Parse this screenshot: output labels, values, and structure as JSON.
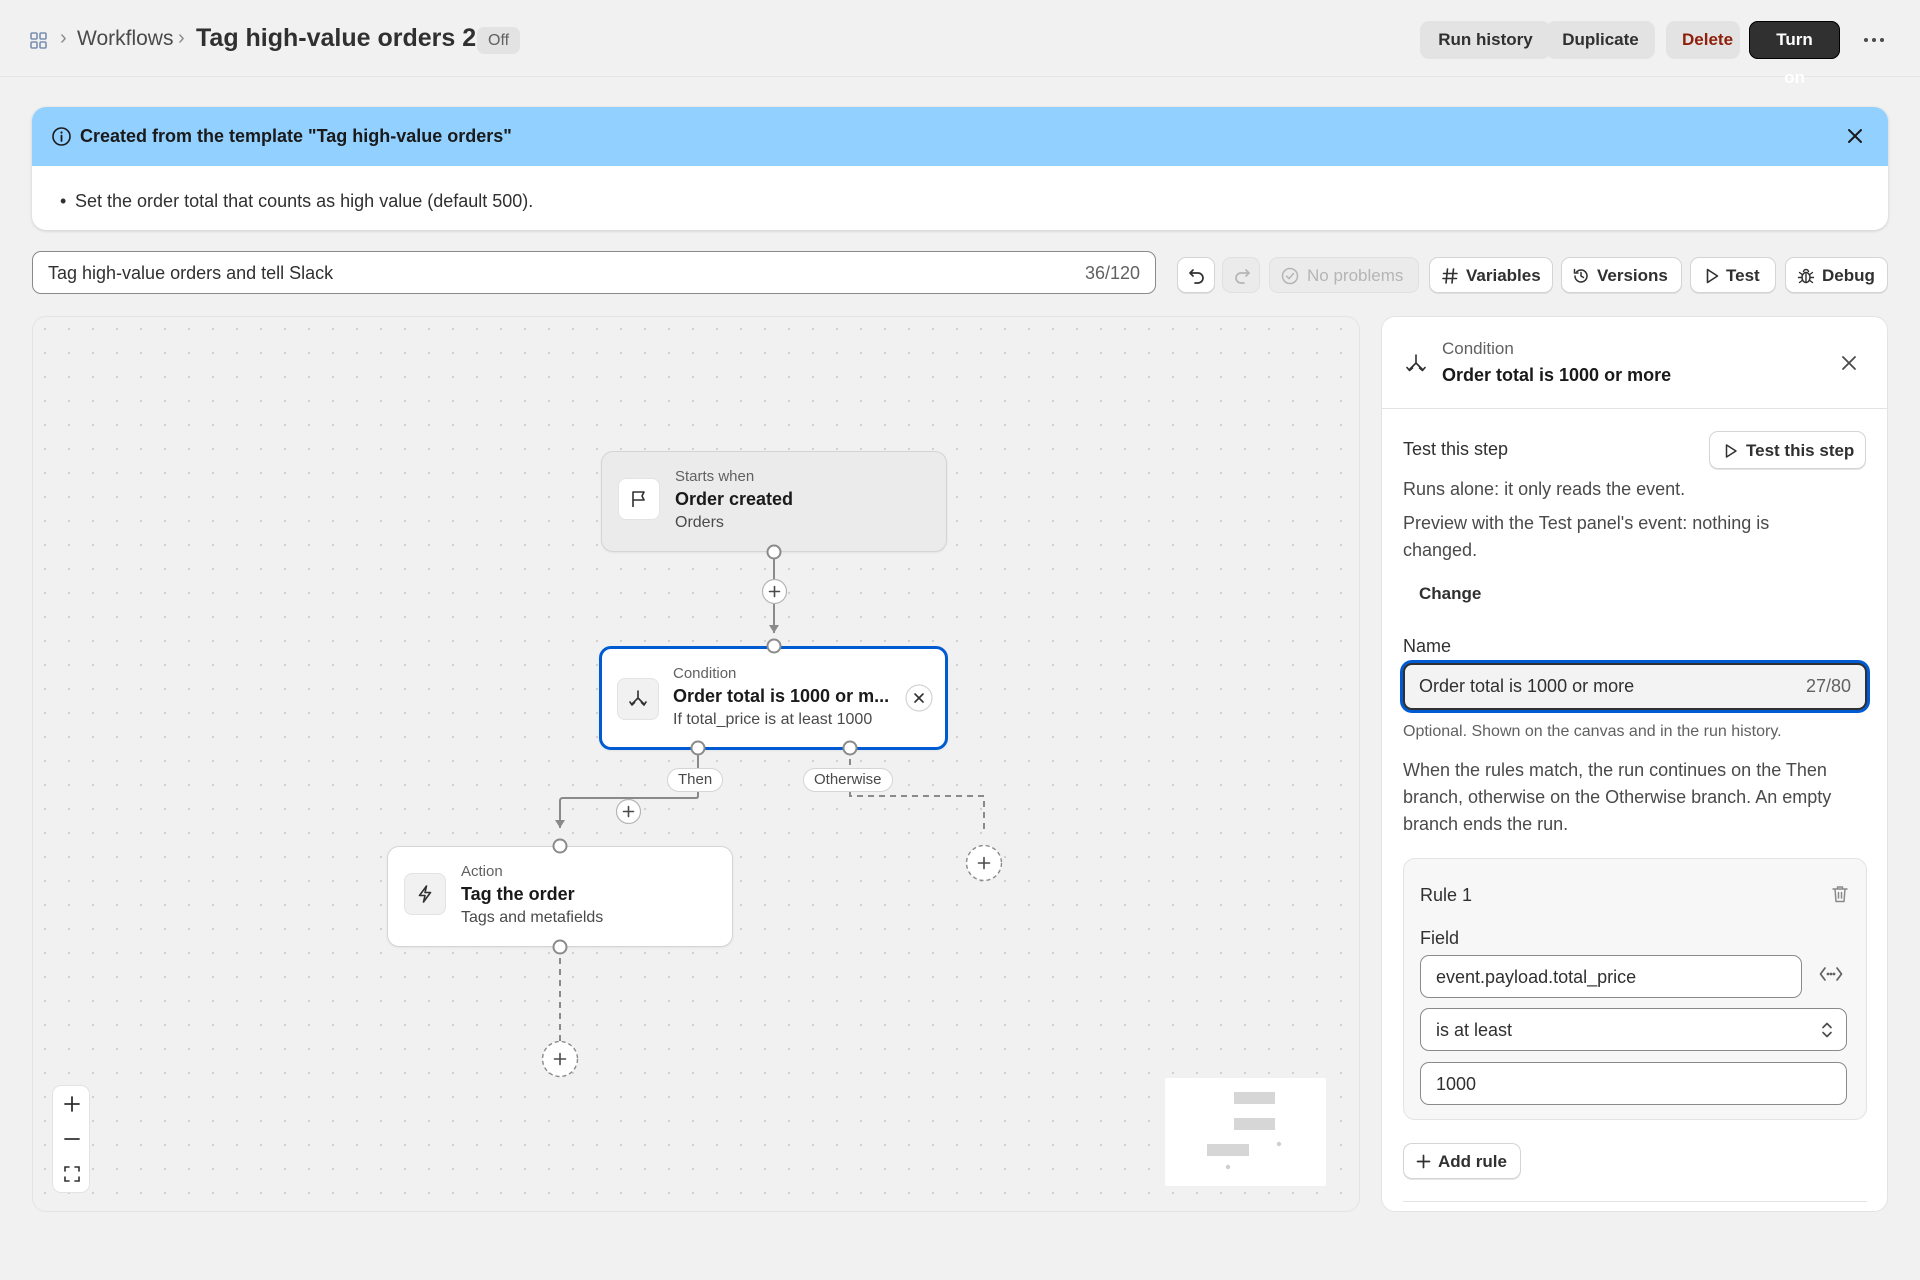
{
  "header": {
    "breadcrumb": "Workflows",
    "title": "Tag high-value orders 2",
    "status": "Off",
    "actions": {
      "run_history": "Run history",
      "duplicate": "Duplicate",
      "delete": "Delete",
      "turn_on": "Turn on"
    }
  },
  "banner": {
    "title": "Created from the template \"Tag high-value orders\"",
    "items": [
      "Set the order total that counts as high value (default 500)."
    ]
  },
  "description": {
    "value": "Tag high-value orders and tell Slack",
    "count": "36/120"
  },
  "toolbar": {
    "status": "No problems",
    "variables": "Variables",
    "versions": "Versions",
    "test": "Test",
    "debug": "Debug"
  },
  "canvas": {
    "trigger": {
      "kicker": "Starts when",
      "title": "Order created",
      "subtitle": "Orders"
    },
    "condition": {
      "kicker": "Condition",
      "title": "Order total is 1000 or m...",
      "subtitle": "If total_price is at least 1000"
    },
    "branches": {
      "then": "Then",
      "otherwise": "Otherwise"
    },
    "action": {
      "kicker": "Action",
      "title": "Tag the order",
      "subtitle": "Tags and metafields"
    }
  },
  "panel": {
    "kicker": "Condition",
    "title": "Order total is 1000 or more",
    "test_heading": "Test this step",
    "test_button": "Test this step",
    "test_desc1": "Runs alone: it only reads the event.",
    "test_desc2": "Preview with the Test panel's event: nothing is changed.",
    "change": "Change",
    "name_label": "Name",
    "name_value": "Order total is 1000 or more",
    "name_count": "27/80",
    "name_help": "Optional. Shown on the canvas and in the run history.",
    "branch_help": "When the rules match, the run continues on the Then branch, otherwise on the Otherwise branch. An empty branch ends the run.",
    "rule": {
      "title": "Rule 1",
      "field_label": "Field",
      "field_value": "event.payload.total_price",
      "operator": "is at least",
      "value": "1000"
    },
    "add_rule": "Add rule"
  }
}
